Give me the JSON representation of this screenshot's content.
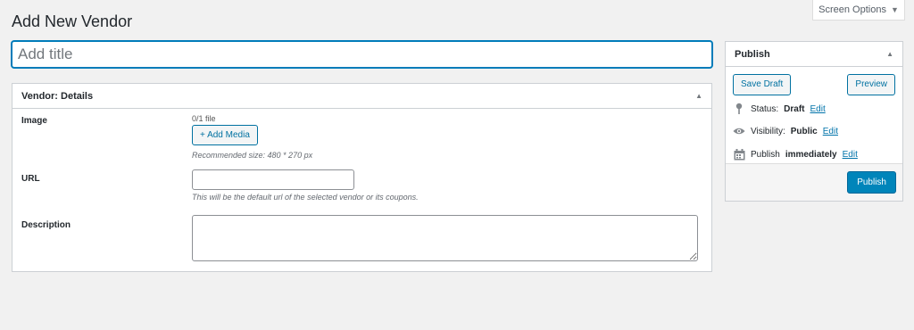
{
  "header": {
    "title": "Add New Vendor",
    "screen_options": "Screen Options"
  },
  "title_field": {
    "placeholder": "Add title",
    "value": ""
  },
  "vendor_box": {
    "title": "Vendor: Details",
    "image": {
      "label": "Image",
      "file_count": "0/1 file",
      "button": "+ Add Media",
      "hint": "Recommended size: 480 * 270 px"
    },
    "url": {
      "label": "URL",
      "value": "",
      "hint": "This will be the default url of the selected vendor or its coupons."
    },
    "description": {
      "label": "Description",
      "value": ""
    }
  },
  "publish_box": {
    "title": "Publish",
    "save_draft": "Save Draft",
    "preview": "Preview",
    "status_label": "Status:",
    "status_value": "Draft",
    "visibility_label": "Visibility:",
    "visibility_value": "Public",
    "publish_label": "Publish",
    "publish_value": "immediately",
    "edit": "Edit",
    "publish_button": "Publish"
  },
  "colors": {
    "accent": "#0071a1",
    "primary_button": "#0085ba",
    "link": "#0073aa",
    "background": "#f1f1f1"
  },
  "icons": [
    "caret-down-icon",
    "toggle-up-icon",
    "pin-icon",
    "eye-icon",
    "calendar-icon"
  ]
}
